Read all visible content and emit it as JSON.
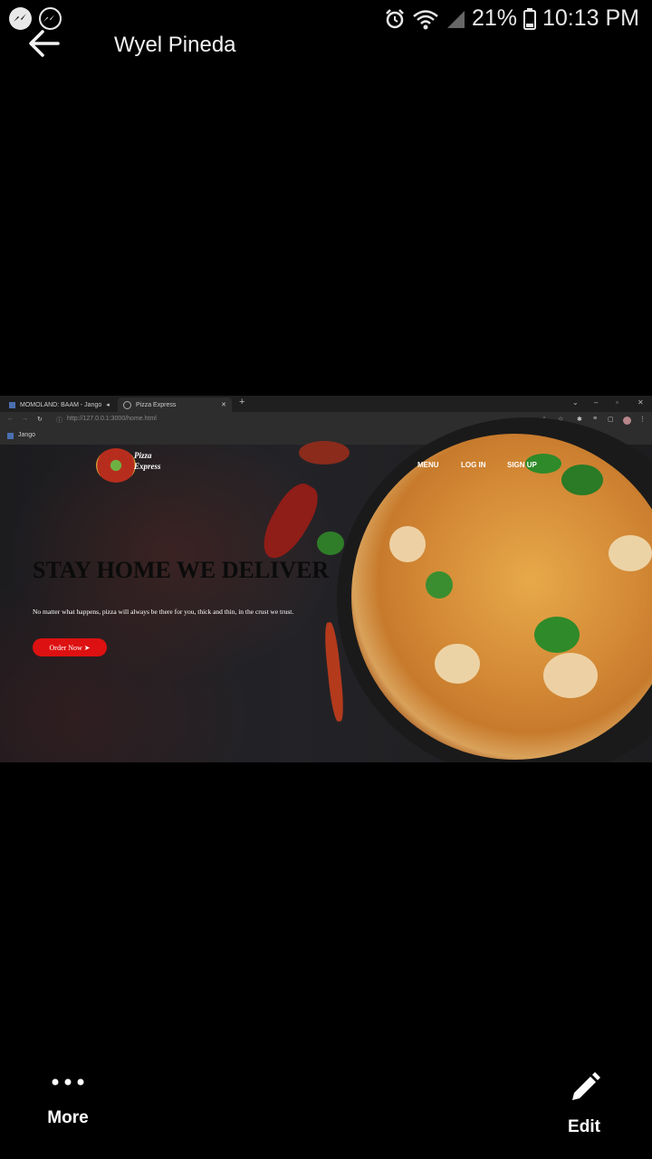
{
  "status_bar": {
    "battery": "21%",
    "time": "10:13 PM",
    "icons": [
      "messenger-icon",
      "messenger-icon",
      "alarm-icon",
      "wifi-icon",
      "signal-icon",
      "battery-icon"
    ]
  },
  "header": {
    "title": "Wyel Pineda",
    "back_icon": "arrow-left-icon"
  },
  "photo": {
    "browser": {
      "tabs": [
        {
          "label": "MOMOLAND: BAAM - Jango",
          "active": false
        },
        {
          "label": "Pizza Express",
          "active": true
        }
      ],
      "url": "http://127.0.0.1:3000/home.html",
      "bookmark": "Jango"
    },
    "site": {
      "logo_line1": "Pizza",
      "logo_line2": "Express",
      "nav": [
        "MENU",
        "LOG IN",
        "SIGN UP"
      ],
      "hero_title": "STAY HOME WE DELIVER",
      "hero_subtitle": "No matter what happens, pizza will always be there for you, thick and thin, in the crust we trust.",
      "order_button": "Order Now ➤"
    }
  },
  "bottom_bar": {
    "more_label": "More",
    "edit_label": "Edit"
  },
  "colors": {
    "background": "#000000",
    "order_button": "#dd1111",
    "text": "#ffffff"
  }
}
